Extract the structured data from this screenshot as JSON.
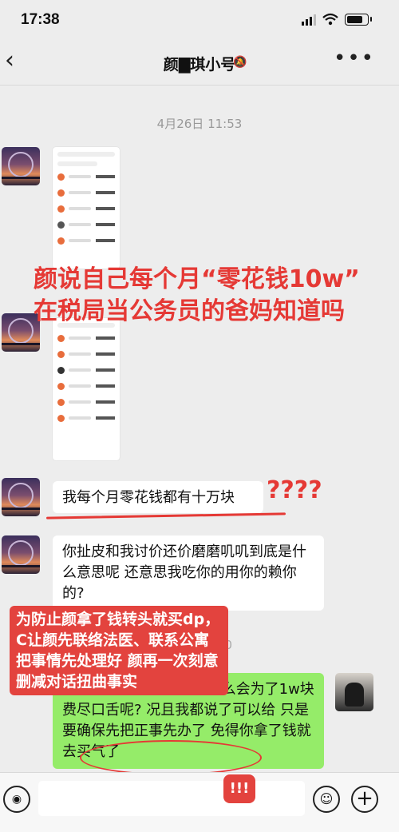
{
  "status": {
    "time": "17:38"
  },
  "header": {
    "title": "颜▇琪小号",
    "mute_icon": "bell-slash-icon",
    "more": "•••"
  },
  "chat": {
    "timestamp": "4月26日 11:53",
    "messages": [
      {
        "text": "我每个月零花钱都有十万块"
      },
      {
        "text": "你扯皮和我讨价还价磨磨叽叽到底是什么意思呢 还意思我吃你的用你的赖你的?"
      },
      {
        "text": "那你每个月都10w的人怎么会为了1w块费尽口舌呢? 况且我都说了可以给 只是要确保先把正事先办了 免得你拿了钱就去买气了"
      }
    ]
  },
  "annotations": {
    "headline": "颜说自己每个月“零花钱10w” 在税局当公务员的爸妈知道吗",
    "question_marks": "????",
    "note": "为防止颜拿了钱转头就买dp，C让颜先联络法医、联系公寓把事情先处理好 颜再一次刻意删减对话扭曲事实",
    "alert": "!!!",
    "faded_ts": "00"
  },
  "colors": {
    "accent_red": "#e53935",
    "bubble_green": "#95ec69"
  }
}
